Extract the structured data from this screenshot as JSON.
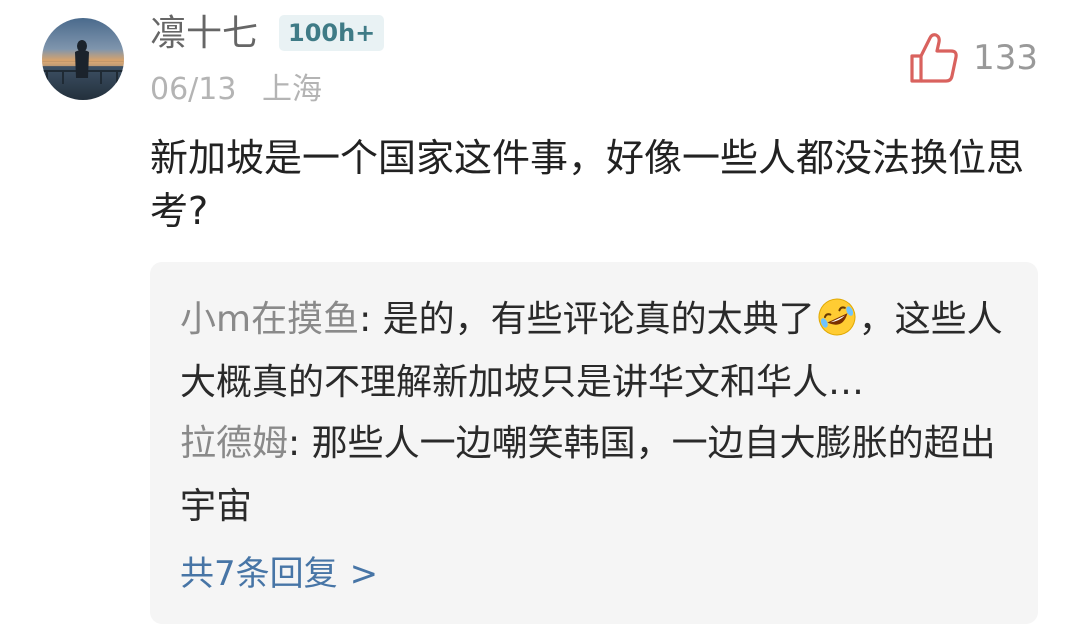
{
  "comment": {
    "username": "凛十七",
    "level_badge": "100h+",
    "date": "06/13",
    "location": "上海",
    "like_count": "133",
    "text": "新加坡是一个国家这件事，好像一些人都没法换位思考?"
  },
  "replies": [
    {
      "author": "小m在摸鱼",
      "text_before_emoji": "是的，有些评论真的太典了",
      "emoji": "rolling-laughing-emoji",
      "text_after_emoji": "，这些人大概真的不理解新加坡只是讲华文和华人…"
    },
    {
      "author": "拉德姆",
      "text": "那些人一边嘲笑韩国，一边自大膨胀的超出宇宙"
    }
  ],
  "more_replies": {
    "label": "共7条回复",
    "chevron": ">"
  },
  "colors": {
    "like_icon": "#d9625e",
    "link": "#4775a6",
    "reply_bg": "#f5f5f5"
  }
}
